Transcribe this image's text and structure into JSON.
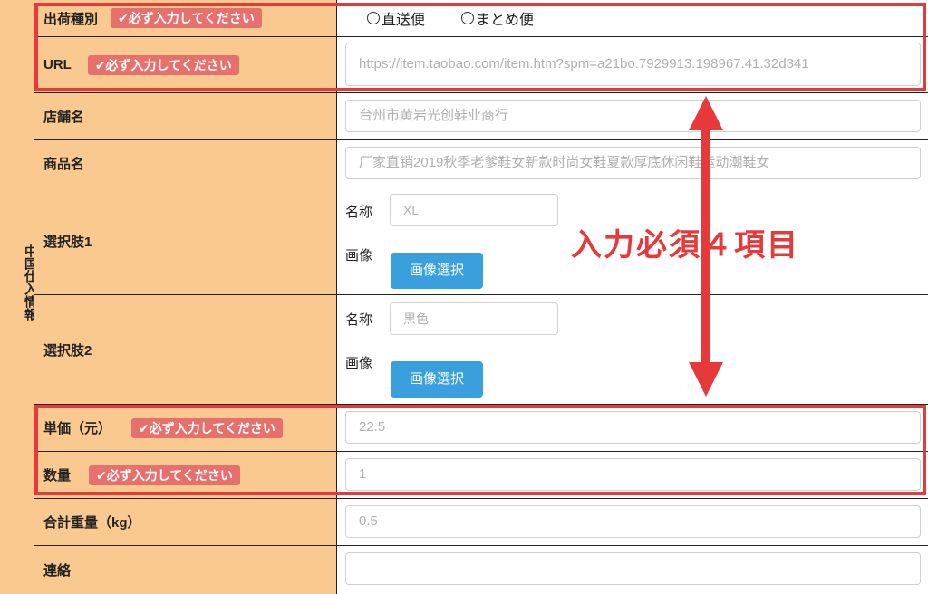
{
  "section": {
    "title": "中国仕入情報"
  },
  "required_badge": "✔必ず入力してください",
  "shipping": {
    "label": "出荷種別",
    "options": [
      "直送便",
      "まとめ便"
    ]
  },
  "url": {
    "label": "URL",
    "value": "https://item.taobao.com/item.htm?spm=a21bo.7929913.198967.41.32d341"
  },
  "shop": {
    "label": "店舗名",
    "value": "台州市黄岩光创鞋业商行"
  },
  "product": {
    "label": "商品名",
    "value": "厂家直销2019秋季老爹鞋女新款时尚女鞋夏款厚底休闲鞋运动潮鞋女"
  },
  "option1": {
    "label": "選択肢1",
    "name_label": "名称",
    "name_value": "XL",
    "image_label": "画像",
    "button": "画像選択"
  },
  "option2": {
    "label": "選択肢2",
    "name_label": "名称",
    "name_value": "黒色",
    "image_label": "画像",
    "button": "画像選択"
  },
  "unit_price": {
    "label": "単価（元）",
    "value": "22.5"
  },
  "quantity": {
    "label": "数量",
    "value": "1"
  },
  "weight": {
    "label": "合計重量（kg）",
    "value": "0.5"
  },
  "contact": {
    "label": "連絡",
    "value": ""
  },
  "annotation": {
    "text": "入力必須４項目",
    "color": "#e8393a"
  },
  "colors": {
    "label_bg": "#f9c98f",
    "badge_bg": "#e8706c",
    "button_bg": "#3aa0dd"
  }
}
